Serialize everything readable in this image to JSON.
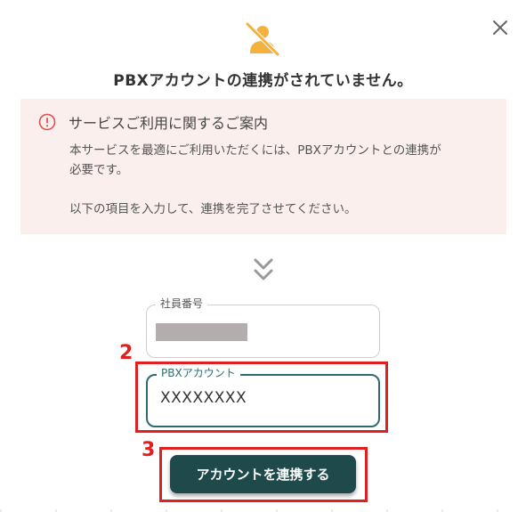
{
  "header": {
    "title": "PBXアカウントの連携がされていません。",
    "hero_icon": "person-off-icon",
    "close_icon": "close-icon",
    "accent_color": "#f5b13d"
  },
  "notice": {
    "icon": "alert-circle-icon",
    "title": "サービスご利用に関するご案内",
    "line1": "本サービスを最適にご利用いただくには、PBXアカウントとの連携が",
    "line2": "必要です。",
    "line3": "以下の項目を入力して、連携を完了させてください。",
    "background": "#fbefed",
    "icon_color": "#e05050"
  },
  "indicator": {
    "icon": "double-chevron-down-icon"
  },
  "form": {
    "employee_id": {
      "label": "社員番号",
      "value_masked": true
    },
    "pbx_account": {
      "label": "PBXアカウント",
      "value": "XXXXXXXX"
    }
  },
  "annotations": {
    "step2": "2",
    "step3": "3",
    "color": "#e02020"
  },
  "submit": {
    "label": "アカウントを連携する",
    "color": "#1e4a4b"
  }
}
